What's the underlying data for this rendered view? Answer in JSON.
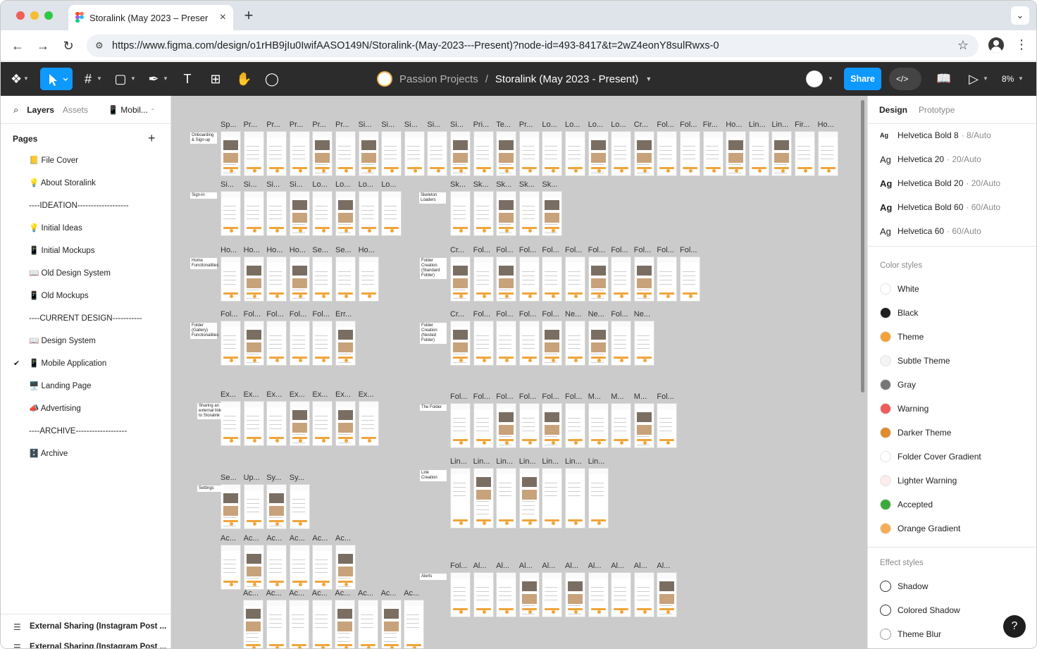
{
  "browser": {
    "tab_title": "Storalink (May 2023 – Preser",
    "tab_close": "×",
    "new_tab": "+",
    "url": "https://www.figma.com/design/o1rHB9jIu0IwifAASO149N/Storalink-(May-2023---Present)?node-id=493-8417&t=2wZ4eonY8sulRwxs-0"
  },
  "toolbar": {
    "breadcrumb_team": "Passion Projects",
    "breadcrumb_sep": "/",
    "file_title": "Storalink (May 2023 - Present)",
    "share_label": "Share",
    "zoom": "8%",
    "dev_mode_glyph": "</>"
  },
  "left_panel": {
    "tabs": {
      "layers": "Layers",
      "assets": "Assets",
      "page_switch": "Mobil..."
    },
    "pages_heading": "Pages",
    "pages": [
      {
        "label": "📒 File Cover"
      },
      {
        "label": "💡 About Storalink"
      },
      {
        "label": "----IDEATION-------------------"
      },
      {
        "label": "💡 Initial Ideas"
      },
      {
        "label": "📱 Initial Mockups"
      },
      {
        "label": "📖 Old Design System"
      },
      {
        "label": "📱 Old Mockups"
      },
      {
        "label": "----CURRENT DESIGN-----------"
      },
      {
        "label": "📖 Design System"
      },
      {
        "label": "📱 Mobile Application",
        "selected": true
      },
      {
        "label": "🖥️ Landing Page"
      },
      {
        "label": "📣 Advertising"
      },
      {
        "label": "----ARCHIVE-------------------"
      },
      {
        "label": "🗄️ Archive"
      }
    ],
    "layers": [
      "External Sharing (Instagram Post ...",
      "External Sharing (Instagram Post ..."
    ]
  },
  "canvas": {
    "sections": [
      "Onboarding & Sign-up",
      "Sign-in",
      "Home Functionalities",
      "Folder (Gallery) Functionalities",
      "Sharing an external link to Storalink",
      "Settings",
      "Skeleton Loaders",
      "Folder Creation (Standard Folder)",
      "Folder Creation (Nested Folder)",
      "The Folder",
      "Link Creation",
      "Alerts"
    ],
    "rows": [
      {
        "labels": [
          "Sp...",
          "Pr...",
          "Pr...",
          "Pr...",
          "Pr...",
          "Pr...",
          "Si...",
          "Si...",
          "Si...",
          "Si...",
          "Si...",
          "Pri...",
          "Te...",
          "Pr...",
          "Lo...",
          "Lo...",
          "Lo...",
          "Lo...",
          "Cr...",
          "Fol...",
          "Fol...",
          "Fir...",
          "Ho...",
          "Lin...",
          "Lin...",
          "Fir...",
          "Ho..."
        ]
      },
      {
        "labels": [
          "Si...",
          "Si...",
          "Si...",
          "Si...",
          "Lo...",
          "Lo...",
          "Lo...",
          "Lo..."
        ]
      },
      {
        "labels": [
          "Sk...",
          "Sk...",
          "Sk...",
          "Sk...",
          "Sk..."
        ]
      },
      {
        "labels": [
          "Ho...",
          "Ho...",
          "Ho...",
          "Ho...",
          "Se...",
          "Se...",
          "Ho..."
        ]
      },
      {
        "labels": [
          "Cr...",
          "Fol...",
          "Fol...",
          "Fol...",
          "Fol...",
          "Fol...",
          "Fol...",
          "Fol...",
          "Fol...",
          "Fol...",
          "Fol..."
        ]
      },
      {
        "labels": [
          "Fol...",
          "Fol...",
          "Fol...",
          "Fol...",
          "Fol...",
          "Err..."
        ]
      },
      {
        "labels": [
          "Cr...",
          "Fol...",
          "Fol...",
          "Fol...",
          "Fol...",
          "Ne...",
          "Ne...",
          "Fol...",
          "Ne..."
        ]
      },
      {
        "labels": [
          "Ex...",
          "Ex...",
          "Ex...",
          "Ex...",
          "Ex...",
          "Ex...",
          "Ex..."
        ]
      },
      {
        "labels": [
          "Fol...",
          "Fol...",
          "Fol...",
          "Fol...",
          "Fol...",
          "Fol...",
          "M...",
          "M...",
          "M...",
          "Fol..."
        ]
      },
      {
        "labels": [
          "Lin...",
          "Lin...",
          "Lin...",
          "Lin...",
          "Lin...",
          "Lin...",
          "Lin..."
        ]
      },
      {
        "labels": [
          "Se...",
          "Up...",
          "Sy...",
          "Sy..."
        ]
      },
      {
        "labels": [
          "Ac...",
          "Ac...",
          "Ac...",
          "Ac...",
          "Ac...",
          "Ac..."
        ]
      },
      {
        "labels": [
          "Ac...",
          "Ac...",
          "Ac...",
          "Ac...",
          "Ac...",
          "Ac...",
          "Ac...",
          "Ac..."
        ]
      },
      {
        "labels": [
          "Fol...",
          "Al...",
          "Al...",
          "Al...",
          "Al...",
          "Al...",
          "Al...",
          "Al...",
          "Al...",
          "Al..."
        ]
      }
    ]
  },
  "right_panel": {
    "tabs": {
      "design": "Design",
      "prototype": "Prototype"
    },
    "text_styles": [
      {
        "ag": "Ag",
        "name": "Helvetica Bold 8",
        "detail": "· 8/Auto"
      },
      {
        "ag": "Ag",
        "name": "Helvetica 20",
        "detail": "· 20/Auto"
      },
      {
        "ag": "Ag",
        "name": "Helvetica Bold 20",
        "detail": "· 20/Auto"
      },
      {
        "ag": "Ag",
        "name": "Helvetica Bold 60",
        "detail": "· 60/Auto"
      },
      {
        "ag": "Ag",
        "name": "Helvetica 60",
        "detail": "· 60/Auto"
      }
    ],
    "color_heading": "Color styles",
    "colors": [
      {
        "name": "White",
        "color": "#FFFFFF"
      },
      {
        "name": "Black",
        "color": "#1E1E1E"
      },
      {
        "name": "Theme",
        "color": "#F2A23A"
      },
      {
        "name": "Subtle Theme",
        "color": "#F4F4F4"
      },
      {
        "name": "Gray",
        "color": "#777777"
      },
      {
        "name": "Warning",
        "color": "#EE5B5B"
      },
      {
        "name": "Darker Theme",
        "color": "#E08A2C"
      },
      {
        "name": "Folder Cover Gradient",
        "color": "#FFFFFF"
      },
      {
        "name": "Lighter Warning",
        "color": "#FDECEC"
      },
      {
        "name": "Accepted",
        "color": "#3BA93B"
      },
      {
        "name": "Orange Gradient",
        "color": "#F5AE55"
      }
    ],
    "effect_heading": "Effect styles",
    "effects": [
      {
        "name": "Shadow",
        "icon": "drop-shadow-icon"
      },
      {
        "name": "Colored Shadow",
        "icon": "drop-shadow-icon"
      },
      {
        "name": "Theme Blur",
        "icon": "blur-icon"
      }
    ]
  },
  "help_label": "?"
}
